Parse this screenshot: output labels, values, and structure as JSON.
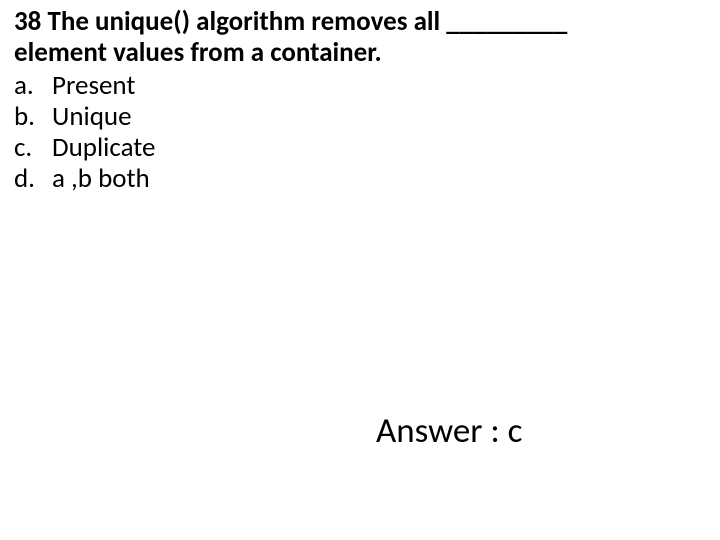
{
  "question": {
    "line1": "38 The unique() algorithm removes all _________",
    "line2": "element values from a container."
  },
  "options": {
    "a": {
      "letter": "a.",
      "text": "Present"
    },
    "b": {
      "letter": "b.",
      "text": "Unique"
    },
    "c": {
      "letter": "c.",
      "text": "Duplicate"
    },
    "d": {
      "letter": "d.",
      "text": "a ,b both"
    }
  },
  "answer": "Answer : c"
}
